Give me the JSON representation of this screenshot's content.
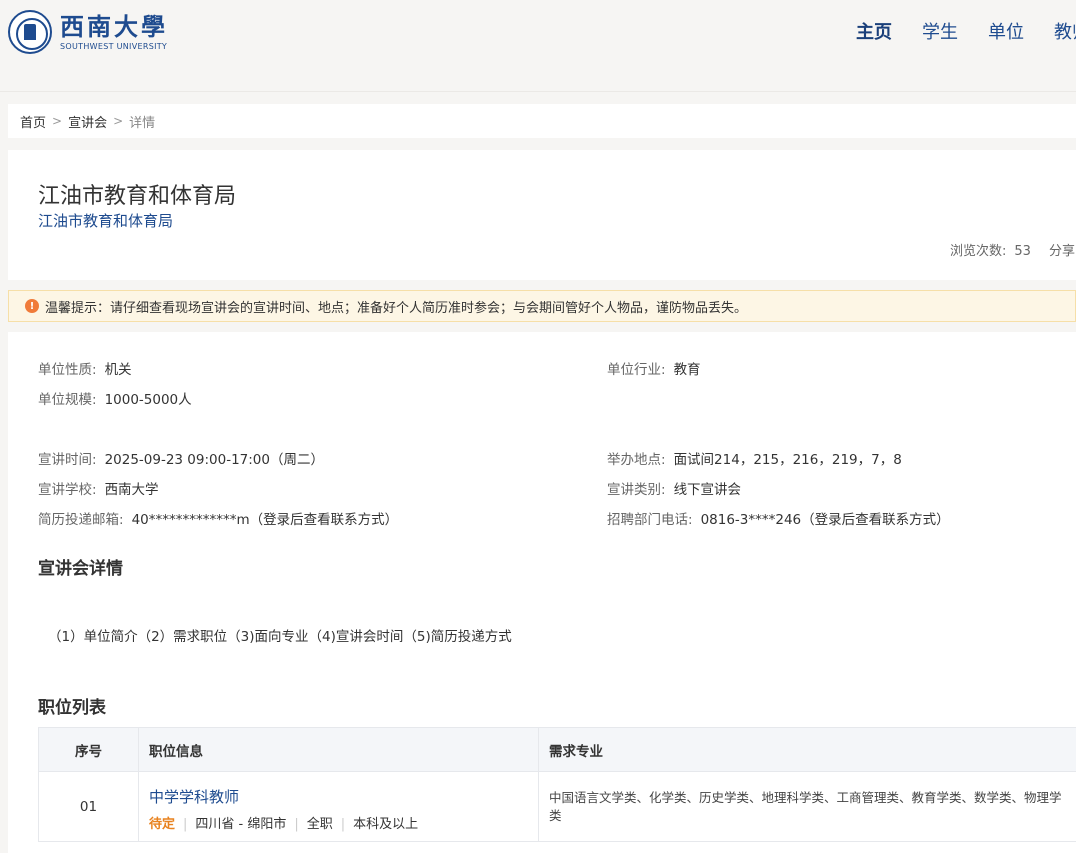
{
  "header": {
    "logo_cn": "西南大學",
    "logo_en": "SOUTHWEST UNIVERSITY",
    "nav": [
      "主页",
      "学生",
      "单位",
      "教师"
    ]
  },
  "breadcrumb": {
    "home": "首页",
    "section": "宣讲会",
    "current": "详情"
  },
  "event": {
    "title": "江油市教育和体育局",
    "company": "江油市教育和体育局",
    "views_label": "浏览次数:",
    "views_count": "53",
    "share_label": "分享"
  },
  "tip": {
    "icon": "!",
    "text": "温馨提示：请仔细查看现场宣讲会的宣讲时间、地点；准备好个人简历准时参会；与会期间管好个人物品，谨防物品丢失。"
  },
  "company_info": {
    "nature_label": "单位性质:",
    "nature": "机关",
    "industry_label": "单位行业:",
    "industry": "教育",
    "scale_label": "单位规模:",
    "scale": "1000-5000人"
  },
  "session_info": {
    "time_label": "宣讲时间:",
    "time": "2025-09-23 09:00-17:00（周二）",
    "place_label": "举办地点:",
    "place": "面试间214，215，216，219，7，8",
    "school_label": "宣讲学校:",
    "school": "西南大学",
    "type_label": "宣讲类别:",
    "type": "线下宣讲会",
    "email_label": "简历投递邮箱:",
    "email": "40*************m（登录后查看联系方式）",
    "phone_label": "招聘部门电话:",
    "phone": "0816-3****246（登录后查看联系方式）"
  },
  "details": {
    "title": "宣讲会详情",
    "content": "（1）单位简介（2）需求职位（3)面向专业（4)宣讲会时间（5)简历投递方式"
  },
  "jobs": {
    "title": "职位列表",
    "columns": [
      "序号",
      "职位信息",
      "需求专业"
    ],
    "rows": [
      {
        "no": "01",
        "name": "中学学科教师",
        "status": "待定",
        "location": "四川省 - 绵阳市",
        "jobtype": "全职",
        "degree": "本科及以上",
        "majors": "中国语言文学类、化学类、历史学类、地理科学类、工商管理类、教育学类、数学类、物理学类"
      }
    ]
  }
}
